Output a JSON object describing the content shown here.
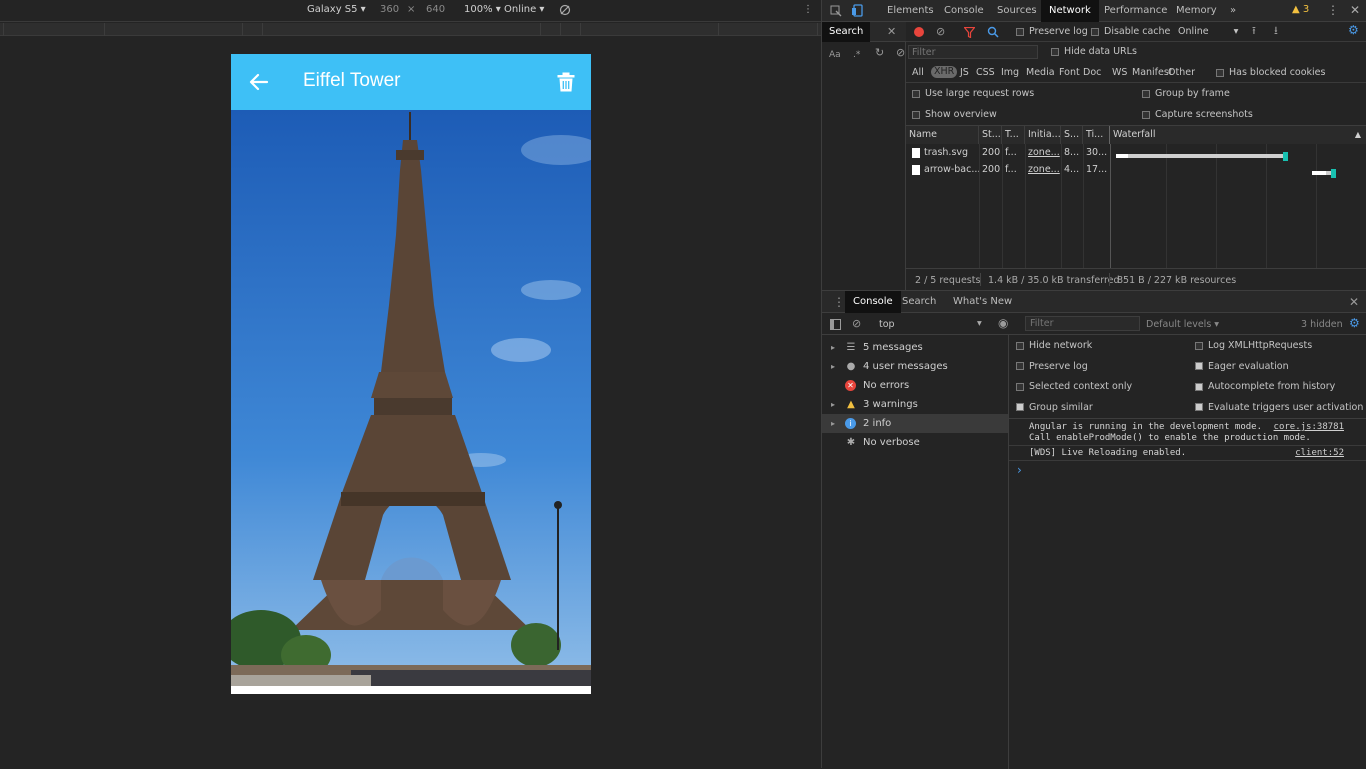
{
  "device_toolbar": {
    "device": "Galaxy S5 ▾",
    "width": "360",
    "times": "×",
    "height": "640",
    "zoom": "100% ▾",
    "throttle": "Online ▾"
  },
  "app": {
    "title": "Eiffel Tower",
    "accent": "#3ec0f6"
  },
  "devtools": {
    "tabs": [
      "Elements",
      "Console",
      "Sources",
      "Network",
      "Performance",
      "Memory",
      "»"
    ],
    "active_tab": "Network",
    "warning_count": "3",
    "search_pane_label": "Search",
    "network": {
      "preserve_log": "Preserve log",
      "disable_cache": "Disable cache",
      "throttle": "Online",
      "filter_placeholder": "Filter",
      "hide_data_urls": "Hide data URLs",
      "types": [
        "All",
        "XHR",
        "JS",
        "CSS",
        "Img",
        "Media",
        "Font",
        "Doc",
        "WS",
        "Manifest",
        "Other"
      ],
      "active_type": "XHR",
      "has_blocked_cookies": "Has blocked cookies",
      "use_large_rows": "Use large request rows",
      "group_by_frame": "Group by frame",
      "show_overview": "Show overview",
      "capture_screenshots": "Capture screenshots",
      "columns": [
        "Name",
        "St...",
        "T...",
        "Initia...",
        "S...",
        "Ti...",
        "Waterfall"
      ],
      "rows": [
        {
          "name": "trash.svg",
          "status": "200",
          "type": "f...",
          "initiator": "zone...",
          "size": "8...",
          "time": "30..."
        },
        {
          "name": "arrow-bac...",
          "status": "200",
          "type": "f...",
          "initiator": "zone...",
          "size": "4...",
          "time": "17..."
        }
      ],
      "status": {
        "requests": "2 / 5 requests",
        "transferred": "1.4 kB / 35.0 kB transferred",
        "resources": "851 B / 227 kB resources"
      }
    },
    "drawer": {
      "tabs": [
        "Console",
        "Search",
        "What's New"
      ],
      "active_tab": "Console",
      "context": "top",
      "filter_placeholder": "Filter",
      "levels": "Default levels ▾",
      "hidden": "3 hidden",
      "sidebar": [
        {
          "label": "5 messages",
          "icon": "list-icon"
        },
        {
          "label": "4 user messages",
          "icon": "user-icon"
        },
        {
          "label": "No errors",
          "icon": "error-icon"
        },
        {
          "label": "3 warnings",
          "icon": "warning-icon"
        },
        {
          "label": "2 info",
          "icon": "info-icon"
        },
        {
          "label": "No verbose",
          "icon": "verbose-icon"
        }
      ],
      "settings_left": [
        "Hide network",
        "Preserve log",
        "Selected context only",
        "Group similar"
      ],
      "settings_right": [
        "Log XMLHttpRequests",
        "Eager evaluation",
        "Autocomplete from history",
        "Evaluate triggers user activation"
      ],
      "logs": [
        {
          "line1": "Angular is running in the development mode.",
          "line2": "Call enableProdMode() to enable the production mode.",
          "source": "core.js:38781"
        },
        {
          "line1": "[WDS] Live Reloading enabled.",
          "line2": "",
          "source": "client:52"
        }
      ],
      "prompt": "›"
    }
  }
}
